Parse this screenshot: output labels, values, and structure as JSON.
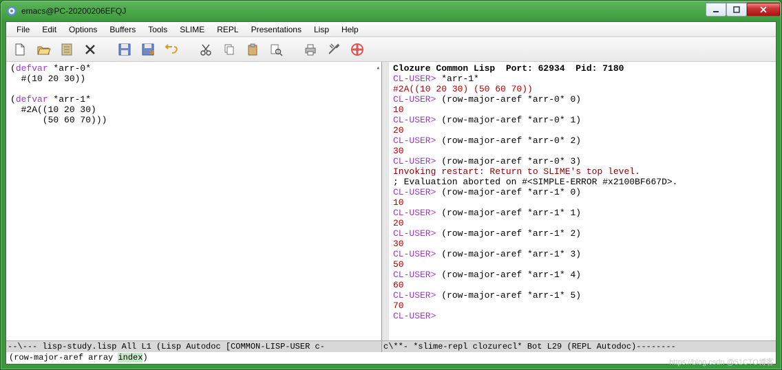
{
  "window": {
    "title": "emacs@PC-20200206EFQJ"
  },
  "menu": [
    "File",
    "Edit",
    "Options",
    "Buffers",
    "Tools",
    "SLIME",
    "REPL",
    "Presentations",
    "Lisp",
    "Help"
  ],
  "editor": {
    "lines": [
      {
        "t": "(",
        "cls": ""
      },
      {
        "t": "defvar",
        "cls": "kw"
      },
      {
        "t": " *arr-0*",
        "cls": ""
      },
      "NL",
      {
        "t": "  #(10 20 30))",
        "cls": ""
      },
      "NL",
      "NL",
      {
        "t": "(",
        "cls": ""
      },
      {
        "t": "defvar",
        "cls": "kw"
      },
      {
        "t": " *arr-1*",
        "cls": ""
      },
      "NL",
      {
        "t": "  #2A((10 20 30)",
        "cls": ""
      },
      "NL",
      {
        "t": "      (50 60 70)))",
        "cls": ""
      }
    ]
  },
  "repl": {
    "header": "Clozure Common Lisp  Port: 62934  Pid: 7180",
    "lines": [
      {
        "prompt": "CL-USER>",
        "body": " *arr-1*"
      },
      {
        "out": "#2A((10 20 30) (50 60 70))",
        "cls": "out"
      },
      {
        "prompt": "CL-USER>",
        "body": " (row-major-aref *arr-0* 0)"
      },
      {
        "out": "10",
        "cls": "out"
      },
      {
        "prompt": "CL-USER>",
        "body": " (row-major-aref *arr-0* 1)"
      },
      {
        "out": "20",
        "cls": "out"
      },
      {
        "prompt": "CL-USER>",
        "body": " (row-major-aref *arr-0* 2)"
      },
      {
        "out": "30",
        "cls": "out"
      },
      {
        "prompt": "CL-USER>",
        "body": " (row-major-aref *arr-0* 3)"
      },
      {
        "out": "Invoking restart: Return to SLIME's top level.",
        "cls": "dark"
      },
      {
        "out": "; Evaluation aborted on #<SIMPLE-ERROR #x2100BF667D>.",
        "cls": ""
      },
      {
        "prompt": "CL-USER>",
        "body": " (row-major-aref *arr-1* 0)"
      },
      {
        "out": "10",
        "cls": "out"
      },
      {
        "prompt": "CL-USER>",
        "body": " (row-major-aref *arr-1* 1)"
      },
      {
        "out": "20",
        "cls": "out"
      },
      {
        "prompt": "CL-USER>",
        "body": " (row-major-aref *arr-1* 2)"
      },
      {
        "out": "30",
        "cls": "out"
      },
      {
        "prompt": "CL-USER>",
        "body": " (row-major-aref *arr-1* 3)"
      },
      {
        "out": "50",
        "cls": "out"
      },
      {
        "prompt": "CL-USER>",
        "body": " (row-major-aref *arr-1* 4)"
      },
      {
        "out": "60",
        "cls": "out"
      },
      {
        "prompt": "CL-USER>",
        "body": " (row-major-aref *arr-1* 5)"
      },
      {
        "out": "70",
        "cls": "out"
      },
      {
        "prompt": "CL-USER>",
        "body": " "
      }
    ]
  },
  "modeline_left": "--\\---  lisp-study.lisp   All L1     (Lisp Autodoc [COMMON-LISP-USER c-",
  "modeline_right": "c\\**-  *slime-repl clozurecl*    Bot L29    (REPL Autodoc)--------",
  "echo": {
    "pre": "(row-major-aref array ",
    "hi": "index",
    "post": ")"
  },
  "watermark": "https://blog.csdn  @51CTO博客"
}
